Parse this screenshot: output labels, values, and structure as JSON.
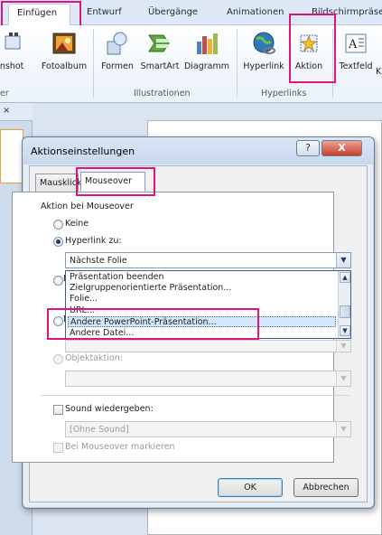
{
  "ribbon": {
    "tabs": [
      "Einfügen",
      "Entwurf",
      "Übergänge",
      "Animationen",
      "Bildschirmpräse"
    ],
    "buttons": [
      "enshot",
      "Fotoalbum",
      "Formen",
      "SmartArt",
      "Diagramm",
      "Hyperlink",
      "Aktion",
      "Textfeld",
      "K"
    ],
    "groups": [
      "er",
      "Illustrationen",
      "Hyperlinks"
    ]
  },
  "workspace": {
    "left_tabs_glyph": "×",
    "slide_fragment": "r"
  },
  "dialog": {
    "title": "Aktionseinstellungen",
    "help": "?",
    "close": "X",
    "tabs": [
      "Mausklick",
      "Mouseover"
    ],
    "section_label": "Aktion bei Mouseover",
    "radio_none": "Keine",
    "radio_hyperlink": "Hyperlink zu:",
    "hyperlink_value": "Nächste Folie",
    "hyperlink_options": [
      "Präsentation beenden",
      "Zielgruppenorientierte Präsentation...",
      "Folie...",
      "URL...",
      "Andere PowerPoint-Präsentation...",
      "Andere Datei..."
    ],
    "hidden_radio_1_letter": "P",
    "hidden_radio_2_letter": "M",
    "radio_object": "Objektaktion:",
    "check_sound": "Sound wiedergeben:",
    "sound_value": "[Ohne Sound]",
    "check_highlight": "Bei Mouseover markieren",
    "ok": "OK",
    "cancel": "Abbrechen"
  }
}
